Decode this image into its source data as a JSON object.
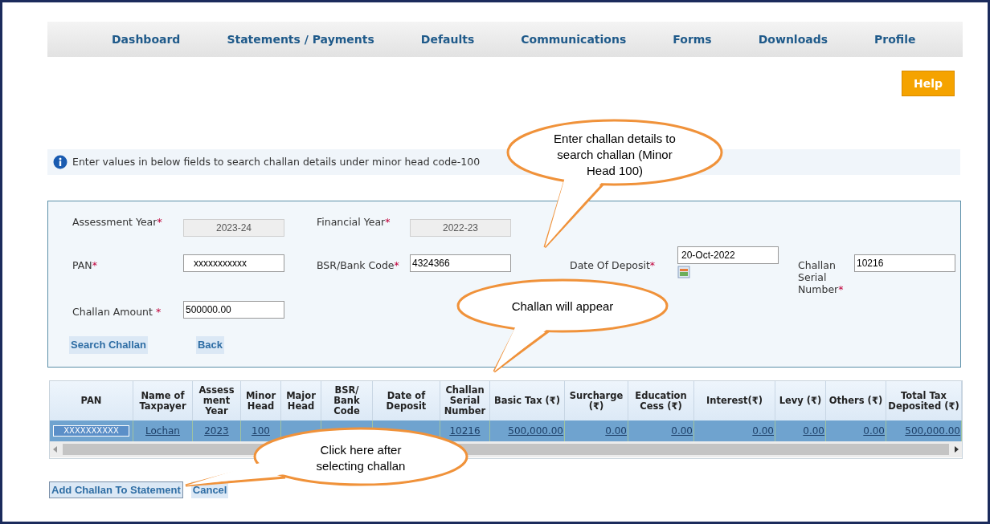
{
  "nav": [
    {
      "label": "Dashboard",
      "selected": false
    },
    {
      "label": "Statements / Payments",
      "selected": false
    },
    {
      "label": "Defaults",
      "selected": false
    },
    {
      "label": "Communications",
      "selected": false
    },
    {
      "label": "Forms",
      "selected": false
    },
    {
      "label": "Downloads",
      "selected": false
    },
    {
      "label": "Profile",
      "selected": false
    }
  ],
  "help_button": "Help",
  "info": "Enter values in below fields to search challan details under minor head code-100",
  "form": {
    "rows": [
      [
        {
          "label": "Assessment Year",
          "required_mark": "*",
          "value": "2023-24",
          "kind": "readonly"
        },
        {
          "label": "Financial Year",
          "required_mark": "*",
          "value": "2022-23",
          "kind": "readonly"
        }
      ],
      [
        {
          "label": "PAN",
          "required_mark": "*",
          "value": "xxxxxxxxxxx",
          "kind": "masked"
        },
        {
          "label": "BSR/Bank Code",
          "required_mark": "*",
          "value": "4324366",
          "kind": "text"
        },
        {
          "label": "Date Of Deposit",
          "required_mark": "*",
          "value": "20-Oct-2022",
          "kind": "date"
        },
        {
          "label": "Challan Serial Number",
          "required_mark": "*",
          "value": "10216",
          "kind": "text"
        }
      ],
      [
        {
          "label": "Challan Amount ",
          "required_mark": "*",
          "value": "500000.00",
          "kind": "text"
        }
      ]
    ],
    "buttons": [
      "Search Challan",
      "Back"
    ]
  },
  "table": {
    "columns": [
      "PAN",
      "Name of Taxpayer",
      "Assess ment Year",
      "Minor Head",
      "Major Head",
      "BSR/ Bank Code",
      "Date of Deposit",
      "Challan Serial Number",
      "Basic Tax (₹)",
      "Surcharge (₹)",
      "Education Cess (₹)",
      "Interest(₹)",
      "Levy (₹)",
      "Others (₹)",
      "Total Tax Deposited (₹)"
    ],
    "rows": [
      {
        "selected": true,
        "cells": [
          "XXXXXXXXXX",
          "Lochan",
          "2023",
          "100",
          "",
          "",
          "",
          "10216",
          "500,000.00",
          "0.00",
          "0.00",
          "0.00",
          "0.00",
          "0.00",
          "500,000.00"
        ]
      }
    ]
  },
  "bottom_buttons": [
    "Add Challan To Statement",
    "Cancel"
  ],
  "callouts": [
    {
      "text": "Enter challan details to search challan (Minor Head 100)"
    },
    {
      "text": "Challan will appear"
    },
    {
      "text": "Click here after selecting challan"
    }
  ]
}
